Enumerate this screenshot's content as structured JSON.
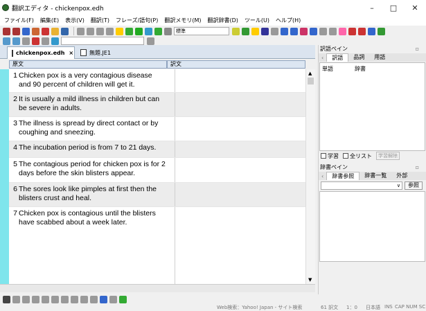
{
  "window": {
    "title": "翻訳エディタ - chickenpox.edh",
    "minimize": "–",
    "maximize": "□",
    "close": "✕"
  },
  "menu": [
    "ファイル(F)",
    "編集(E)",
    "表示(V)",
    "翻訳(T)",
    "フレーズ/語句(P)",
    "翻訳メモリ(M)",
    "翻訳辞書(D)",
    "ツール(U)",
    "ヘルプ(H)"
  ],
  "toolbar": {
    "style_combo": "標準"
  },
  "tabs": [
    {
      "label": "chickenpox.edh",
      "close": "×"
    },
    {
      "label": "無題.JE1"
    }
  ],
  "columns": {
    "source": "原文",
    "target": "訳文"
  },
  "rows": [
    {
      "num": "1",
      "text": "Chicken pox is a very contagious disease and 90 percent of children will get it."
    },
    {
      "num": "2",
      "text": "It is usually a mild illness in children but can be severe in adults."
    },
    {
      "num": "3",
      "text": "The illness is spread by direct contact or by coughing and sneezing."
    },
    {
      "num": "4",
      "text": "The incubation period is from 7 to 21 days."
    },
    {
      "num": "5",
      "text": "The contagious period for chicken pox is for 2 days before the skin blisters appear."
    },
    {
      "num": "6",
      "text": "The sores look like pimples at first then the blisters crust and heal."
    },
    {
      "num": "7",
      "text": "Chicken pox is contagious until the blisters have scabbed about a week later."
    }
  ],
  "trans_pane": {
    "title": "訳語ペイン",
    "tabs": [
      "訳語",
      "品詞",
      "用語"
    ],
    "col_word": "単語",
    "col_dict": "辞書",
    "learn": "学習",
    "all_list": "全リスト",
    "learn_clear": "学習解除"
  },
  "dict_pane": {
    "title": "辞書ペイン",
    "tabs": [
      "辞書参照",
      "辞書一覧",
      "外部"
    ],
    "ref_button": "参照"
  },
  "status": {
    "web_search": "Web検索：Yahoo! Japan - サイト検索",
    "pos": "61 訳文",
    "line": "1：0",
    "lang": "日本語",
    "ins": "INS",
    "caps": "CAP NUM SC"
  }
}
